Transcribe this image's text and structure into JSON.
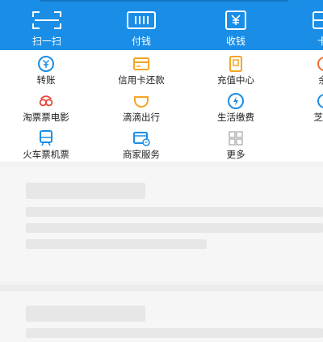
{
  "top_bar": {
    "items": [
      {
        "label": "扫一扫",
        "icon": "scan-icon"
      },
      {
        "label": "付钱",
        "icon": "barcode-icon"
      },
      {
        "label": "收钱",
        "icon": "yuan-wallet-icon"
      },
      {
        "label": "卡",
        "icon": "card-icon"
      }
    ]
  },
  "grid": {
    "items": [
      {
        "label": "转账",
        "icon": "transfer-icon",
        "color": "#1a8ee6"
      },
      {
        "label": "信用卡还款",
        "icon": "credit-card-icon",
        "color": "#f5a623"
      },
      {
        "label": "充值中心",
        "icon": "phone-recharge-icon",
        "color": "#f5a623"
      },
      {
        "label": "余",
        "icon": "yuebao-icon",
        "color": "#f56c2a"
      },
      {
        "label": "淘票票电影",
        "icon": "movie-icon",
        "color": "#e8483b"
      },
      {
        "label": "滴滴出行",
        "icon": "didi-icon",
        "color": "#f5a623"
      },
      {
        "label": "生活缴费",
        "icon": "utility-bill-icon",
        "color": "#1a8ee6"
      },
      {
        "label": "芝麻",
        "icon": "sesame-icon",
        "color": "#1a8ee6"
      },
      {
        "label": "火车票机票",
        "icon": "train-ticket-icon",
        "color": "#1a8ee6"
      },
      {
        "label": "商家服务",
        "icon": "merchant-service-icon",
        "color": "#1a8ee6"
      },
      {
        "label": "更多",
        "icon": "more-grid-icon",
        "color": "#b5b5b5"
      }
    ]
  },
  "colors": {
    "header_blue": "#1a8ee6",
    "accent_orange": "#f5a623",
    "accent_red": "#e8483b",
    "placeholder_gray": "#e7e7e7"
  }
}
